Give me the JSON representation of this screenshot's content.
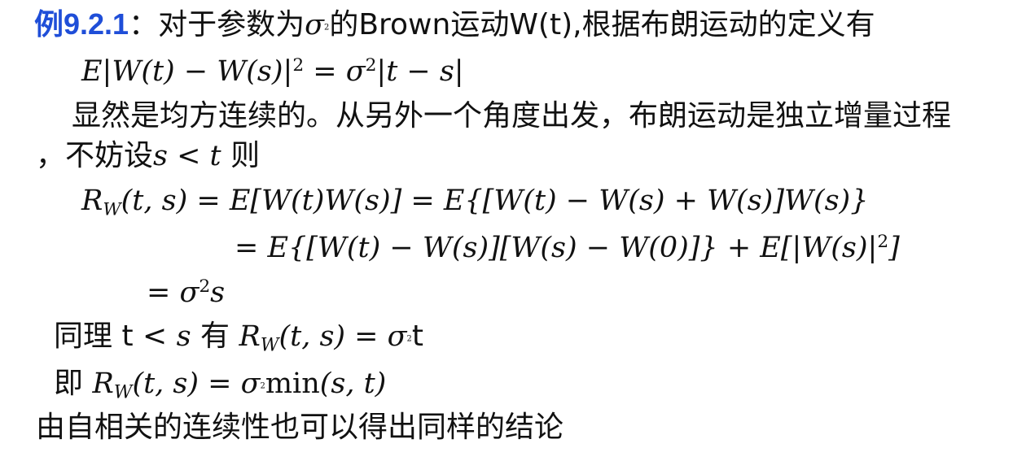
{
  "example": {
    "label": "例9.2.1",
    "colon": "：",
    "intro_a": "对于参数为",
    "sigma": "σ",
    "sq": "2",
    "intro_b": "的Brown运动W(t),根据布朗运动的定义有"
  },
  "eq1": {
    "lhs": "E|W(t) − W(s)|",
    "exp": "2",
    "mid": " = σ",
    "exp2": "2",
    "rhs": "|t − s|"
  },
  "paragraph": {
    "line1": "显然是均方连续的。从另外一个角度出发，布朗运动是独立增量过程",
    "line2_a": "，不妨设",
    "line2_math": "s < t",
    "line2_b": " 则"
  },
  "derivation": {
    "row1": "R",
    "row1_sub": "W",
    "row1_rest": "(t, s) = E[W(t)W(s)] = E{[W(t) − W(s) + W(s)]W(s)}",
    "row2_a": "= E{[W(t) − W(s)][W(s) − W(0)]} + E[|W(s)|",
    "row2_exp": "2",
    "row2_b": "]",
    "row3_a": "= σ",
    "row3_exp": "2",
    "row3_b": "s"
  },
  "similarly": {
    "prefix": "同理 t < ",
    "s": "s",
    "have": "   有 ",
    "R": "R",
    "sub": "W",
    "mid": "(t, s) = σ",
    "exp": "2",
    "t": "t"
  },
  "therefore": {
    "prefix": "即   ",
    "R": "R",
    "sub": "W",
    "mid": "(t, s) = σ",
    "exp": "2",
    "min": "min",
    "args": "(s, t)"
  },
  "conclusion": "由自相关的连续性也可以得出同样的结论"
}
